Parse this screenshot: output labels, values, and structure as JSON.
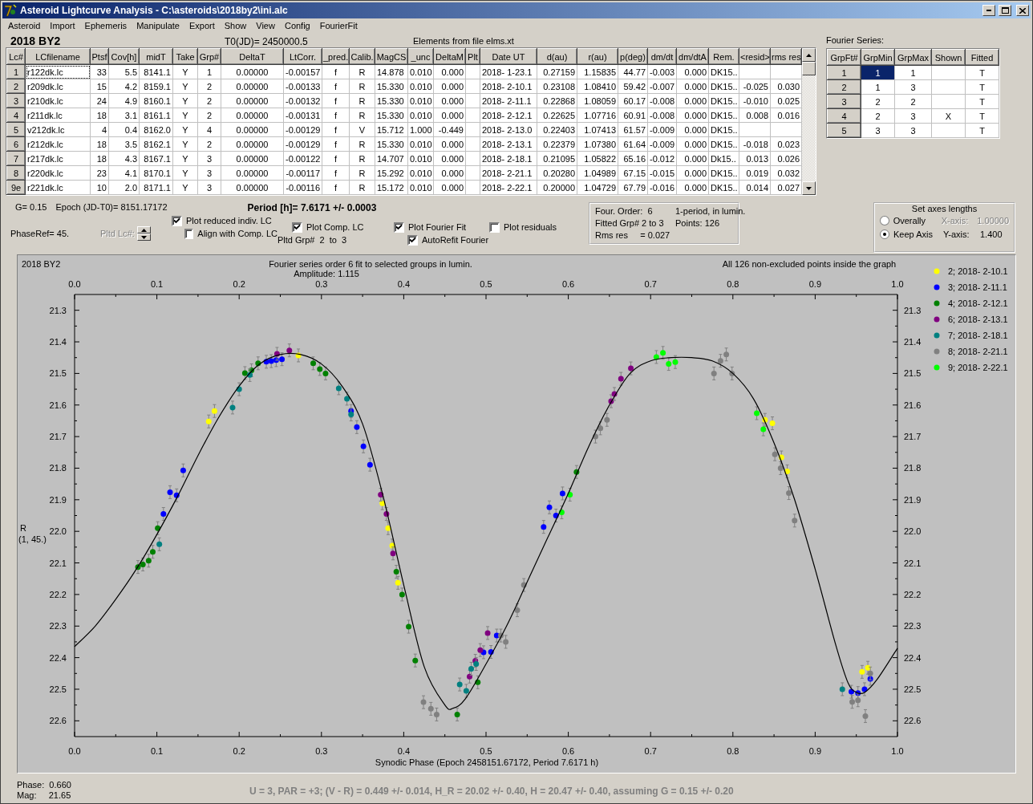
{
  "window": {
    "title": "Asteroid Lightcurve Analysis - C:\\asteroids\\2018by2\\ini.alc"
  },
  "menu": [
    "Asteroid",
    "Import",
    "Ephemeris",
    "Manipulate",
    "Export",
    "Show",
    "View",
    "Config",
    "FourierFit"
  ],
  "header": {
    "asteroid": "2018 BY2",
    "t0": "T0(JD)= 2450000.5",
    "elements": "Elements from file elms.xt"
  },
  "lc_table": {
    "columns": [
      "Lc#",
      "LCfilename",
      "Ptsf",
      "Cov[h]",
      "midT",
      "Take",
      "Grp#",
      "DeltaT",
      "LtCorr.",
      "_pred.",
      "Calib.",
      "MagCS",
      "_unc",
      "DeltaM",
      "Plt",
      "Date UT",
      "d(au)",
      "r(au)",
      "p(deg)",
      "dm/dt",
      "dm/dtA",
      "Rem.",
      "<resid>",
      "rms res"
    ],
    "rows": [
      {
        "focused": true,
        "cells": [
          "1",
          "r122dk.lc",
          "33",
          "5.5",
          "8141.1",
          "Y",
          "1",
          "0.00000",
          "-0.00157",
          "f",
          "R",
          "14.878",
          "0.010",
          "0.000",
          "",
          "2018- 1-23.1",
          "0.27159",
          "1.15835",
          "44.77",
          "-0.003",
          "0.000",
          "DK15..",
          "",
          ""
        ]
      },
      {
        "focused": false,
        "cells": [
          "2",
          "r209dk.lc",
          "15",
          "4.2",
          "8159.1",
          "Y",
          "2",
          "0.00000",
          "-0.00133",
          "f",
          "R",
          "15.330",
          "0.010",
          "0.000",
          "",
          "2018- 2-10.1",
          "0.23108",
          "1.08410",
          "59.42",
          "-0.007",
          "0.000",
          "DK15..",
          "-0.025",
          "0.030"
        ]
      },
      {
        "focused": false,
        "cells": [
          "3",
          "r210dk.lc",
          "24",
          "4.9",
          "8160.1",
          "Y",
          "2",
          "0.00000",
          "-0.00132",
          "f",
          "R",
          "15.330",
          "0.010",
          "0.000",
          "",
          "2018- 2-11.1",
          "0.22868",
          "1.08059",
          "60.17",
          "-0.008",
          "0.000",
          "DK15..",
          "-0.010",
          "0.025"
        ]
      },
      {
        "focused": false,
        "cells": [
          "4",
          "r211dk.lc",
          "18",
          "3.1",
          "8161.1",
          "Y",
          "2",
          "0.00000",
          "-0.00131",
          "f",
          "R",
          "15.330",
          "0.010",
          "0.000",
          "",
          "2018- 2-12.1",
          "0.22625",
          "1.07716",
          "60.91",
          "-0.008",
          "0.000",
          "DK15..",
          "0.008",
          "0.016"
        ]
      },
      {
        "focused": false,
        "cells": [
          "5",
          "v212dk.lc",
          "4",
          "0.4",
          "8162.0",
          "Y",
          "4",
          "0.00000",
          "-0.00129",
          "f",
          "V",
          "15.712",
          "1.000",
          "-0.449",
          "",
          "2018- 2-13.0",
          "0.22403",
          "1.07413",
          "61.57",
          "-0.009",
          "0.000",
          "DK15..",
          "",
          ""
        ]
      },
      {
        "focused": false,
        "cells": [
          "6",
          "r212dk.lc",
          "18",
          "3.5",
          "8162.1",
          "Y",
          "2",
          "0.00000",
          "-0.00129",
          "f",
          "R",
          "15.330",
          "0.010",
          "0.000",
          "",
          "2018- 2-13.1",
          "0.22379",
          "1.07380",
          "61.64",
          "-0.009",
          "0.000",
          "DK15..",
          "-0.018",
          "0.023"
        ]
      },
      {
        "focused": false,
        "cells": [
          "7",
          "r217dk.lc",
          "18",
          "4.3",
          "8167.1",
          "Y",
          "3",
          "0.00000",
          "-0.00122",
          "f",
          "R",
          "14.707",
          "0.010",
          "0.000",
          "",
          "2018- 2-18.1",
          "0.21095",
          "1.05822",
          "65.16",
          "-0.012",
          "0.000",
          "Dk15..",
          "0.013",
          "0.026"
        ]
      },
      {
        "focused": false,
        "cells": [
          "8",
          "r220dk.lc",
          "23",
          "4.1",
          "8170.1",
          "Y",
          "3",
          "0.00000",
          "-0.00117",
          "f",
          "R",
          "15.292",
          "0.010",
          "0.000",
          "",
          "2018- 2-21.1",
          "0.20280",
          "1.04989",
          "67.15",
          "-0.015",
          "0.000",
          "DK15..",
          "0.019",
          "0.032"
        ]
      },
      {
        "focused": false,
        "cells": [
          "9e",
          "r221dk.lc",
          "10",
          "2.0",
          "8171.1",
          "Y",
          "3",
          "0.00000",
          "-0.00116",
          "f",
          "R",
          "15.172",
          "0.010",
          "0.000",
          "",
          "2018- 2-22.1",
          "0.20000",
          "1.04729",
          "67.79",
          "-0.016",
          "0.000",
          "DK15..",
          "0.014",
          "0.027"
        ]
      }
    ]
  },
  "fourier_series": {
    "title": "Fourier Series:",
    "columns": [
      "GrpFt#",
      "GrpMin",
      "GrpMax",
      "Shown",
      "Fitted"
    ],
    "rows": [
      {
        "selected": true,
        "cells": [
          "1",
          "1",
          "1",
          "",
          "T"
        ]
      },
      {
        "selected": false,
        "cells": [
          "2",
          "1",
          "3",
          "",
          "T"
        ]
      },
      {
        "selected": false,
        "cells": [
          "3",
          "2",
          "2",
          "",
          "T"
        ]
      },
      {
        "selected": false,
        "cells": [
          "4",
          "2",
          "3",
          "X",
          "T"
        ]
      },
      {
        "selected": false,
        "cells": [
          "5",
          "3",
          "3",
          "",
          "T"
        ]
      }
    ]
  },
  "fit_info": {
    "g": "G= 0.15",
    "epoch": "Epoch (JD-T0)= 8151.17172",
    "period": "Period [h]= 7.6171 +/- 0.0003",
    "phase_ref": "PhaseRef= 45.",
    "pltd_lc": {
      "label": "Pltd Lc#:",
      "disabled": true
    },
    "pltd_grp": "Pltd Grp#  2  to  3"
  },
  "options": [
    {
      "label": "Plot reduced indiv. LC",
      "checked": true
    },
    {
      "label": "Align with Comp. LC",
      "checked": false
    },
    {
      "label": "Plot Comp. LC",
      "checked": true
    },
    {
      "label": "Plot Fourier Fit",
      "checked": true
    },
    {
      "label": "AutoRefit Fourier",
      "checked": true
    },
    {
      "label": "Plot residuals",
      "checked": false
    }
  ],
  "fourier_box": {
    "lines": [
      [
        "Four. Order:  6",
        "1-period, in lumin."
      ],
      [
        "Fitted Grp# 2 to 3",
        "Points: 126"
      ],
      [
        "Rms res     = 0.027"
      ]
    ]
  },
  "axes": {
    "title": "Set axes lengths",
    "options": [
      {
        "label": "Overally",
        "selected": false,
        "axis_label": "X-axis:",
        "value": "1.00000",
        "disabled": true
      },
      {
        "label": "Keep Axis",
        "selected": true,
        "axis_label": "Y-axis:",
        "value": "1.400",
        "disabled": false
      }
    ]
  },
  "plot": {
    "object": "2018 BY2",
    "subtitle": "Amplitude: 1.115",
    "note": "All 126 non-excluded points inside the graph",
    "ylabel_note": "(1, 45.)",
    "chart_data": {
      "type": "scatter",
      "title": "Fourier series order 6 fit to selected groups in lumin.",
      "xlabel": "Synodic Phase (Epoch 2458151.67172, Period 7.6171 h)",
      "ylabel": "R",
      "xlim": [
        0,
        1
      ],
      "ylim": [
        22.65,
        21.25
      ],
      "legend": "right",
      "xticks": [
        {
          "value": 0,
          "label": "0.0"
        },
        {
          "value": 0.1,
          "label": "0.1"
        },
        {
          "value": 0.2,
          "label": "0.2"
        },
        {
          "value": 0.3,
          "label": "0.3"
        },
        {
          "value": 0.4,
          "label": "0.4"
        },
        {
          "value": 0.5,
          "label": "0.5"
        },
        {
          "value": 0.6,
          "label": "0.6"
        },
        {
          "value": 0.7,
          "label": "0.7"
        },
        {
          "value": 0.8,
          "label": "0.8"
        },
        {
          "value": 0.9,
          "label": "0.9"
        },
        {
          "value": 1,
          "label": "1.0"
        }
      ],
      "yticks": [
        {
          "value": 21.3,
          "label": "21.3"
        },
        {
          "value": 21.4,
          "label": "21.4"
        },
        {
          "value": 21.5,
          "label": "21.5"
        },
        {
          "value": 21.6,
          "label": "21.6"
        },
        {
          "value": 21.7,
          "label": "21.7"
        },
        {
          "value": 21.8,
          "label": "21.8"
        },
        {
          "value": 21.9,
          "label": "21.9"
        },
        {
          "value": 22.0,
          "label": "22.0"
        },
        {
          "value": 22.1,
          "label": "22.1"
        },
        {
          "value": 22.2,
          "label": "22.2"
        },
        {
          "value": 22.3,
          "label": "22.3"
        },
        {
          "value": 22.4,
          "label": "22.4"
        },
        {
          "value": 22.5,
          "label": "22.5"
        },
        {
          "value": 22.6,
          "label": "22.6"
        }
      ],
      "series": [
        {
          "name": "2; 2018- 2-10.1",
          "color": "#ffff00",
          "x": [
            0.163,
            0.17,
            0.272,
            0.374,
            0.381,
            0.386,
            0.393,
            0.839,
            0.848,
            0.859,
            0.866,
            0.957,
            0.964
          ],
          "values": [
            21.652,
            21.619,
            21.443,
            21.911,
            21.99,
            22.045,
            22.163,
            21.647,
            21.658,
            21.766,
            21.81,
            22.445,
            22.432
          ]
        },
        {
          "name": "3; 2018- 2-11.1",
          "color": "#0000ff",
          "x": [
            0.108,
            0.116,
            0.124,
            0.132,
            0.233,
            0.239,
            0.245,
            0.252,
            0.336,
            0.343,
            0.351,
            0.359,
            0.497,
            0.506,
            0.513,
            0.57,
            0.577,
            0.585,
            0.593,
            0.944,
            0.952,
            0.96,
            0.967
          ],
          "values": [
            21.945,
            21.876,
            21.886,
            21.807,
            21.463,
            21.461,
            21.458,
            21.455,
            21.619,
            21.67,
            21.731,
            21.789,
            22.383,
            22.382,
            22.33,
            21.986,
            21.924,
            21.95,
            21.88,
            22.508,
            22.512,
            22.5,
            22.467
          ]
        },
        {
          "name": "4; 2018- 2-12.1",
          "color": "#008000",
          "x": [
            0.077,
            0.083,
            0.09,
            0.095,
            0.101,
            0.207,
            0.215,
            0.223,
            0.29,
            0.298,
            0.305,
            0.391,
            0.398,
            0.406,
            0.414,
            0.465,
            0.49,
            0.61
          ],
          "values": [
            22.113,
            22.105,
            22.093,
            22.065,
            21.99,
            21.499,
            21.49,
            21.468,
            21.468,
            21.486,
            21.5,
            22.128,
            22.2,
            22.302,
            22.409,
            22.58,
            22.478,
            21.812
          ]
        },
        {
          "name": "6; 2018- 2-13.1",
          "color": "#800080",
          "x": [
            0.246,
            0.261,
            0.372,
            0.379,
            0.387,
            0.48,
            0.487,
            0.493,
            0.502,
            0.652,
            0.656,
            0.664,
            0.676
          ],
          "values": [
            21.438,
            21.427,
            21.884,
            21.945,
            22.07,
            22.46,
            22.41,
            22.376,
            22.322,
            21.588,
            21.565,
            21.517,
            21.484
          ]
        },
        {
          "name": "7; 2018- 2-18.1",
          "color": "#008080",
          "x": [
            0.103,
            0.192,
            0.2,
            0.213,
            0.321,
            0.331,
            0.336,
            0.468,
            0.476,
            0.482,
            0.488,
            0.933
          ],
          "values": [
            22.041,
            21.608,
            21.55,
            21.505,
            21.547,
            21.58,
            21.63,
            22.485,
            22.505,
            22.435,
            22.42,
            22.5
          ]
        },
        {
          "name": "8; 2018- 2-21.1",
          "color": "#808080",
          "x": [
            0.424,
            0.433,
            0.44,
            0.518,
            0.524,
            0.538,
            0.546,
            0.633,
            0.639,
            0.647,
            0.777,
            0.785,
            0.792,
            0.799,
            0.851,
            0.858,
            0.868,
            0.875,
            0.945,
            0.952,
            0.961,
            0.967
          ],
          "values": [
            22.541,
            22.562,
            22.58,
            22.33,
            22.35,
            22.25,
            22.17,
            21.7,
            21.674,
            21.647,
            21.5,
            21.46,
            21.44,
            21.5,
            21.756,
            21.8,
            21.879,
            21.966,
            22.54,
            22.535,
            22.585,
            22.45
          ]
        },
        {
          "name": "9; 2018- 2-22.1",
          "color": "#00ff00",
          "x": [
            0.592,
            0.602,
            0.707,
            0.715,
            0.722,
            0.73,
            0.829,
            0.837
          ],
          "values": [
            21.94,
            21.884,
            21.448,
            21.435,
            21.47,
            21.464,
            21.626,
            21.677
          ]
        },
        {
          "type": "line",
          "color": "#000000",
          "x": [
            0,
            0.025,
            0.05,
            0.075,
            0.1,
            0.125,
            0.15,
            0.175,
            0.2,
            0.225,
            0.25,
            0.275,
            0.3,
            0.325,
            0.35,
            0.375,
            0.4,
            0.425,
            0.45,
            0.46,
            0.475,
            0.5,
            0.525,
            0.55,
            0.575,
            0.6,
            0.625,
            0.65,
            0.675,
            0.7,
            0.725,
            0.75,
            0.775,
            0.8,
            0.825,
            0.85,
            0.875,
            0.9,
            0.925,
            0.94,
            0.95,
            0.96,
            0.975,
            1
          ],
          "values": [
            22.365,
            22.3,
            22.215,
            22.12,
            22.01,
            21.89,
            21.76,
            21.64,
            21.54,
            21.47,
            21.44,
            21.44,
            21.47,
            21.54,
            21.66,
            21.89,
            22.17,
            22.43,
            22.55,
            22.56,
            22.53,
            22.42,
            22.3,
            22.16,
            22.02,
            21.88,
            21.73,
            21.6,
            21.5,
            21.46,
            21.45,
            21.45,
            21.46,
            21.5,
            21.58,
            21.72,
            21.9,
            22.12,
            22.36,
            22.48,
            22.51,
            22.51,
            22.47,
            22.37
          ]
        }
      ]
    }
  },
  "status": {
    "phase": "Phase:  0.660",
    "mag": "Mag:     21.65",
    "summary": "U = 3, PAR = +3; (V - R) = 0.449 +/- 0.014, H_R = 20.02 +/- 0.40, H = 20.47 +/- 0.40, assuming G = 0.15 +/- 0.20"
  }
}
